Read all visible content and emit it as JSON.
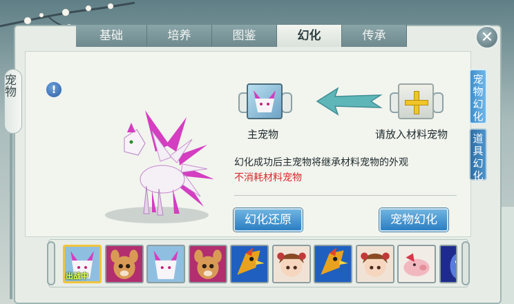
{
  "tabs": [
    "基础",
    "培养",
    "图鉴",
    "幻化",
    "传承"
  ],
  "active_tab": "幻化",
  "left_tab_label": "宠物",
  "right_tabs": [
    {
      "label": "宠物幻化",
      "active": true
    },
    {
      "label": "道具幻化",
      "active": false
    }
  ],
  "info_icon_text": "!",
  "close_icon": "close-icon",
  "main_pet_label": "主宠物",
  "material_pet_label": "请放入材料宠物",
  "description": "幻化成功后主宠物将继承材料宠物的外观",
  "warning": "不消耗材料宠物",
  "buttons": {
    "restore": "幻化还原",
    "transform": "宠物幻化"
  },
  "pet_list": [
    {
      "kind": "fox",
      "selected": true,
      "badge": "出战中"
    },
    {
      "kind": "deer",
      "selected": false
    },
    {
      "kind": "fox",
      "selected": false
    },
    {
      "kind": "deer",
      "selected": false
    },
    {
      "kind": "bird",
      "selected": false
    },
    {
      "kind": "girl",
      "selected": false
    },
    {
      "kind": "bird",
      "selected": false
    },
    {
      "kind": "girl",
      "selected": false
    },
    {
      "kind": "pig",
      "selected": false
    },
    {
      "kind": "spirit",
      "selected": false
    }
  ],
  "colors": {
    "accent": "#2b7ec3",
    "warning": "#d8282a",
    "pet_pink": "#d43ec0"
  }
}
